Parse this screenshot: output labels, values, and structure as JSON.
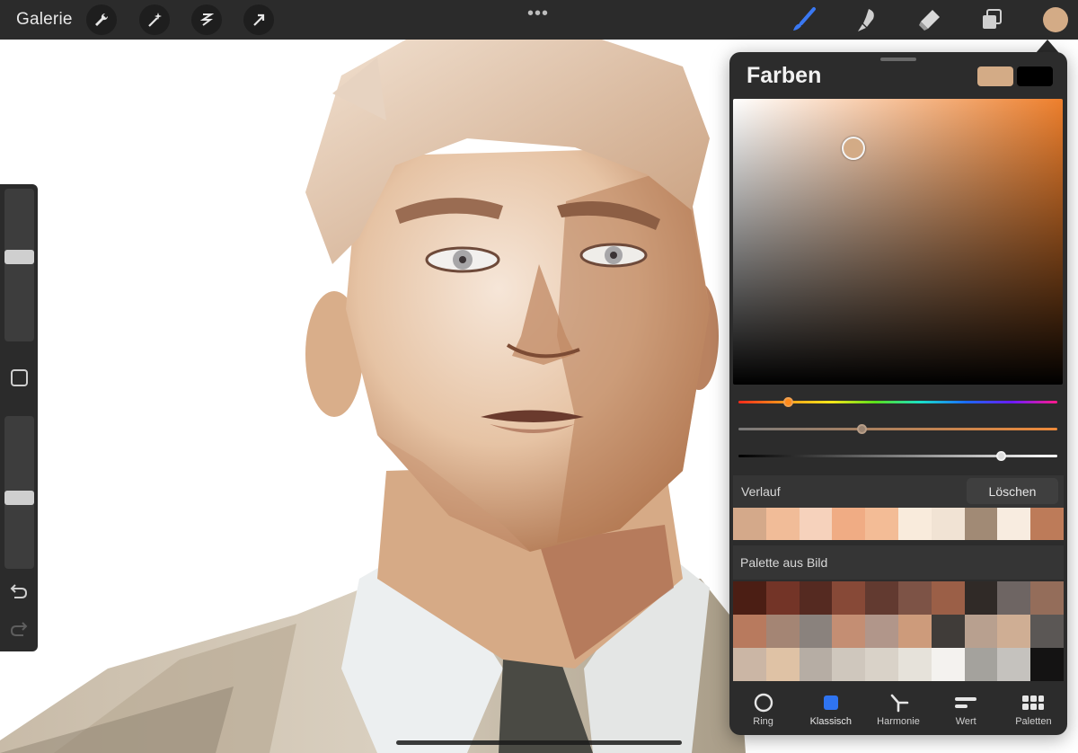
{
  "topbar": {
    "gallery_label": "Galerie",
    "left_tools": [
      "wrench-icon",
      "magic-wand-icon",
      "selection-icon",
      "transform-arrow-icon"
    ],
    "more_label": "•••",
    "right_tools": [
      "brush-icon",
      "smudge-icon",
      "eraser-icon",
      "layers-icon"
    ],
    "active_color": "#d3ab86"
  },
  "sidebar": {
    "brush_size_level": 0.56,
    "opacity_level": 0.46,
    "tools": [
      "modify-square-icon",
      "undo-icon",
      "redo-icon"
    ]
  },
  "colors_panel": {
    "title": "Farben",
    "primary_color": "#d3ab86",
    "secondary_color": "#000000",
    "hue_position": 0.154,
    "saturation_position": 0.386,
    "brightness_position": 0.823,
    "history": {
      "label": "Verlauf",
      "clear_label": "Löschen",
      "swatches": [
        "#d4a98a",
        "#f1bc98",
        "#f6d2bc",
        "#f0ac84",
        "#f3bc96",
        "#f9ebdc",
        "#f1e3d4",
        "#a18a75",
        "#f8ece0",
        "#bd7b59"
      ]
    },
    "palette": {
      "label": "Palette aus Bild",
      "swatches": [
        "#4b1e14",
        "#733427",
        "#552a21",
        "#874937",
        "#623a30",
        "#7d5346",
        "#9b5f47",
        "#302a27",
        "#6e6563",
        "#946d5a",
        "#b87a5e",
        "#a48574",
        "#8a827d",
        "#c48e73",
        "#b1968a",
        "#cd9b7b",
        "#403c39",
        "#b8a08f",
        "#cfae94",
        "#5b5755",
        "#cbb6a5",
        "#dfc2a5",
        "#b6ada4",
        "#cfc7bd",
        "#d9d2c8",
        "#e6e2da",
        "#f4f2ef",
        "#a4a29d",
        "#c5c2be",
        "#141313"
      ]
    },
    "tabs": [
      {
        "label": "Ring",
        "icon": "ring-icon"
      },
      {
        "label": "Klassisch",
        "icon": "classic-square-icon"
      },
      {
        "label": "Harmonie",
        "icon": "harmony-icon"
      },
      {
        "label": "Wert",
        "icon": "value-sliders-icon"
      },
      {
        "label": "Paletten",
        "icon": "palettes-grid-icon"
      }
    ],
    "active_tab": "Klassisch"
  }
}
